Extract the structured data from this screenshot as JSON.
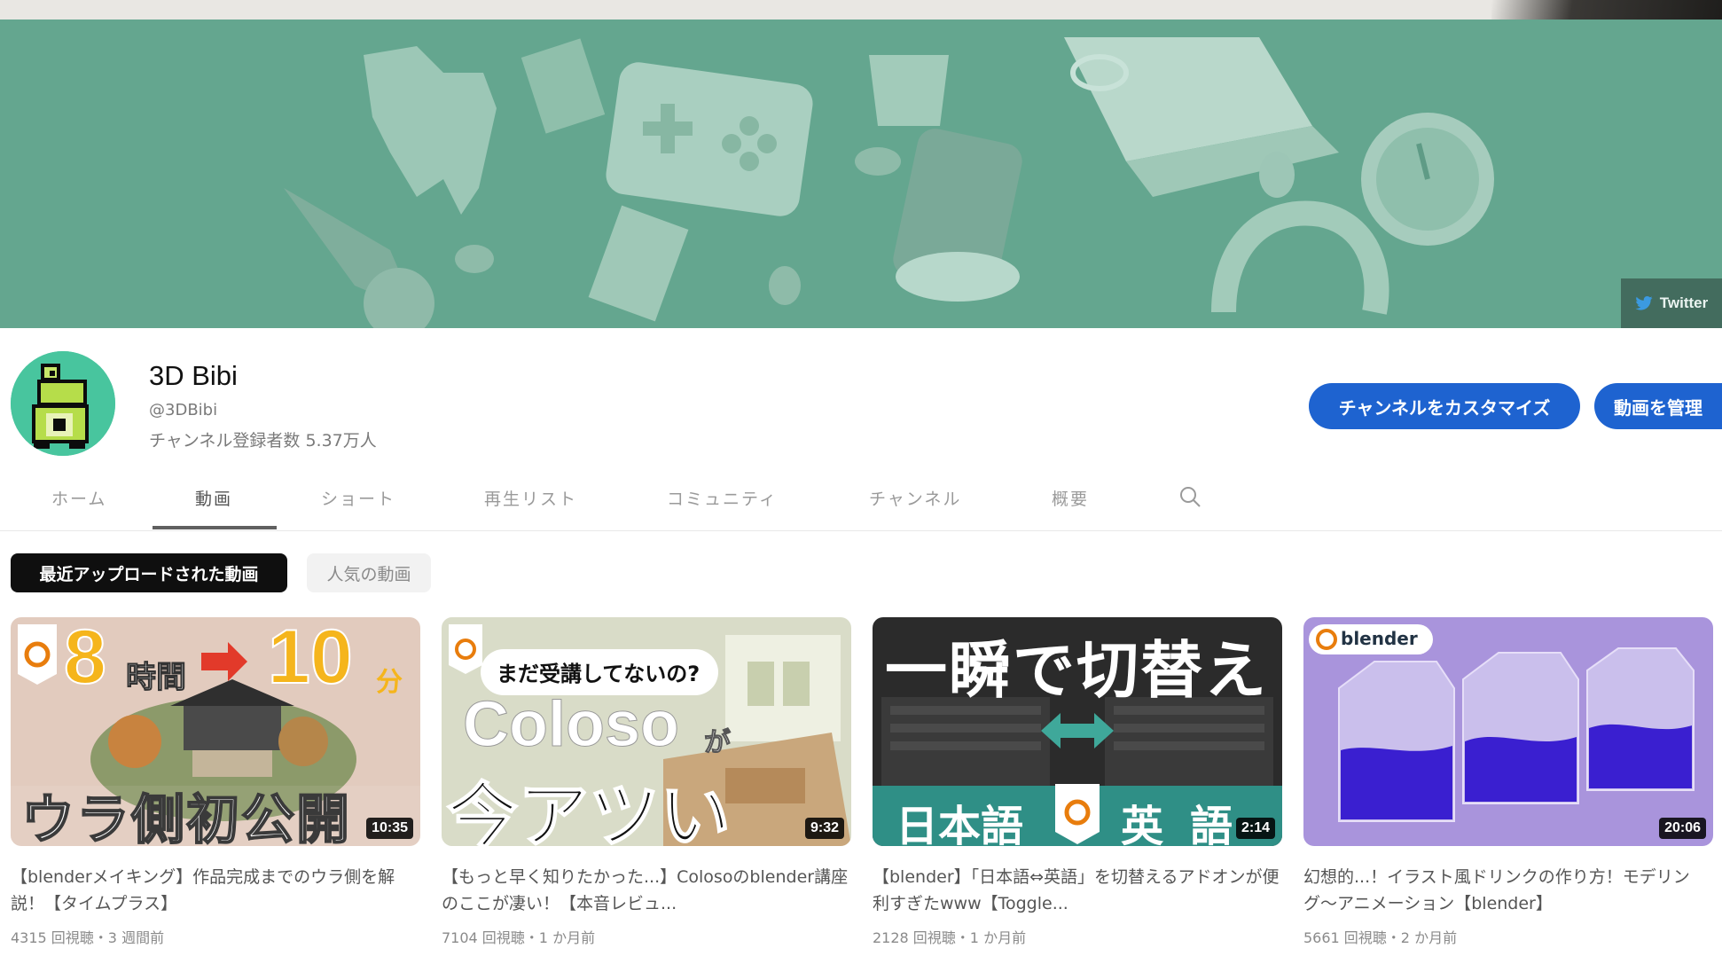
{
  "banner": {
    "twitter_label": "Twitter",
    "background_color": "#64a68f"
  },
  "channel": {
    "name": "3D Bibi",
    "handle": "@3DBibi",
    "subscribers": "チャンネル登録者数 5.37万人",
    "avatar_color": "#48c59e",
    "customize_button": "チャンネルをカスタマイズ",
    "manage_button": "動画を管理"
  },
  "tabs": [
    {
      "label": "ホーム"
    },
    {
      "label": "動画"
    },
    {
      "label": "ショート"
    },
    {
      "label": "再生リスト"
    },
    {
      "label": "コミュニティ"
    },
    {
      "label": "チャンネル"
    },
    {
      "label": "概要"
    }
  ],
  "active_tab": "動画",
  "chips": {
    "recent": "最近アップロードされた動画",
    "popular": "人気の動画"
  },
  "videos": [
    {
      "thumb_text_top_left": "8",
      "thumb_text_hours": "時間",
      "thumb_text_ten": "10",
      "thumb_text_minutes": "分",
      "thumb_text_bottom": "ウラ側初公開",
      "duration": "10:35",
      "title": "【blenderメイキング】作品完成までのウラ側を解説！【タイムプラス】",
      "meta": "4315 回視聴・3 週間前"
    },
    {
      "thumb_text_bubble": "まだ受講してないの?",
      "thumb_text_brand": "Coloso",
      "thumb_text_ga": "が",
      "thumb_text_bottom": "今アツい",
      "duration": "9:32",
      "title": "【もっと早く知りたかった...】Colosoのblender講座のここが凄い！【本音レビュ...",
      "meta": "7104 回視聴・1 か月前"
    },
    {
      "thumb_text_top": "一瞬で切替え",
      "thumb_text_left": "日本語",
      "thumb_text_right": "英語",
      "duration": "2:14",
      "title": "【blender】「日本語⇔英語」を切替えるアドオンが便利すぎたwww【Toggle...",
      "meta": "2128 回視聴・1 か月前"
    },
    {
      "thumb_text_logo": "blender",
      "duration": "20:06",
      "title": "幻想的...！イラスト風ドリンクの作り方！モデリング〜アニメーション【blender】",
      "meta": "5661 回視聴・2 か月前"
    }
  ]
}
